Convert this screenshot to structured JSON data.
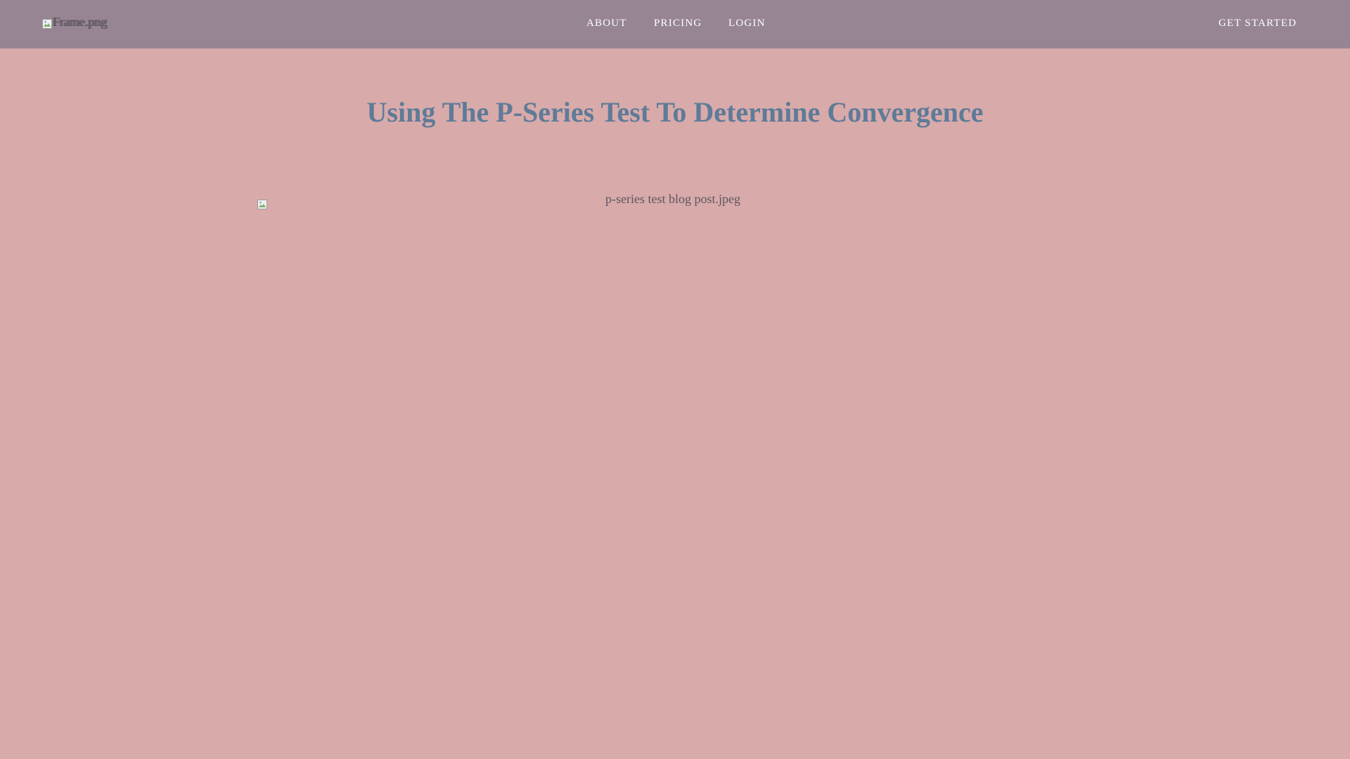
{
  "header": {
    "logo_alt_1": "Frame.png",
    "logo_alt_2": "Frame.png",
    "nav": {
      "about": "ABOUT",
      "pricing": "PRICING",
      "login": "LOGIN",
      "get_started": "GET STARTED"
    },
    "colors": {
      "bar": "#978594",
      "link": "#ffffff"
    }
  },
  "main": {
    "title": "Using The P-Series Test To Determine Convergence",
    "hero_image_alt": "p-series test blog post.jpeg",
    "colors": {
      "background": "#d8aaaa",
      "title": "#5e7b98"
    }
  }
}
